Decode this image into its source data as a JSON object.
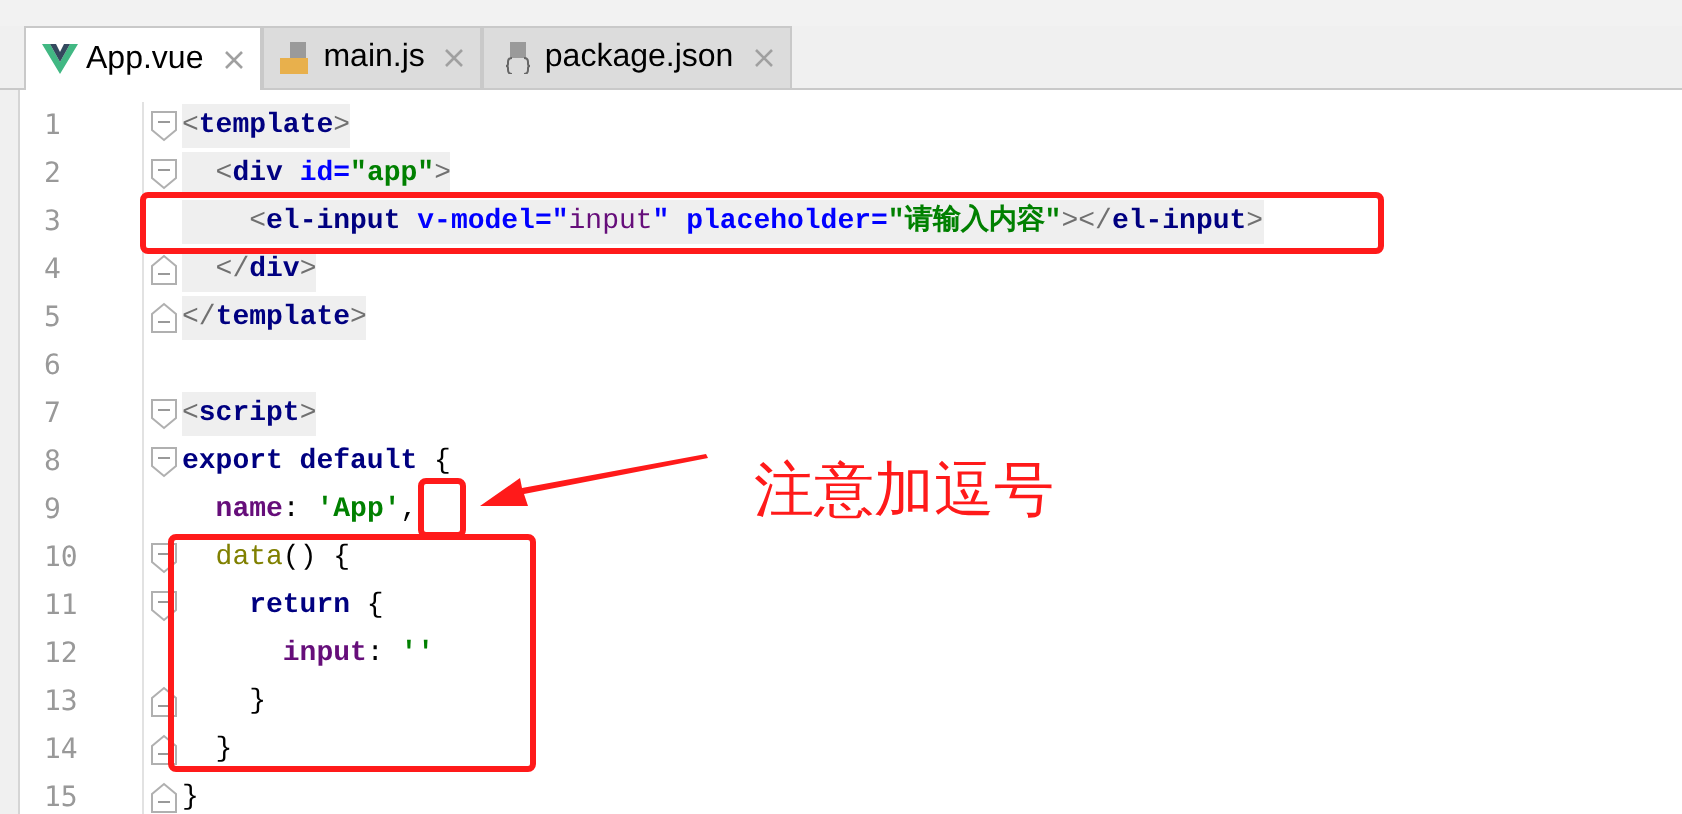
{
  "tabs": [
    {
      "label": "App.vue",
      "kind": "vue",
      "selected": true
    },
    {
      "label": "main.js",
      "kind": "js",
      "selected": false
    },
    {
      "label": "package.json",
      "kind": "json",
      "selected": false
    }
  ],
  "lines": [
    {
      "number": "1",
      "kind": "fold-start",
      "highlighted": true,
      "tokens": [
        {
          "kind": "bracket",
          "text": "<"
        },
        {
          "kind": "tag",
          "text": "template"
        },
        {
          "kind": "bracket",
          "text": ">"
        }
      ]
    },
    {
      "number": "2",
      "kind": "fold-start",
      "highlighted": true,
      "tokens": [
        {
          "kind": "bracket",
          "text": "  <"
        },
        {
          "kind": "tag",
          "text": "div "
        },
        {
          "kind": "attr",
          "text": "id="
        },
        {
          "kind": "string",
          "text": "\"app\""
        },
        {
          "kind": "bracket",
          "text": ">"
        }
      ]
    },
    {
      "number": "3",
      "kind": "plain",
      "highlighted": true,
      "tokens": [
        {
          "kind": "bracket",
          "text": "    <"
        },
        {
          "kind": "tag",
          "text": "el-input "
        },
        {
          "kind": "attr",
          "text": "v-model="
        },
        {
          "kind": "attr",
          "text": "\""
        },
        {
          "kind": "binding",
          "text": "input"
        },
        {
          "kind": "attr",
          "text": "\" placeholder="
        },
        {
          "kind": "string",
          "text": "\"请输入内容\""
        },
        {
          "kind": "bracket",
          "text": "></"
        },
        {
          "kind": "tag",
          "text": "el-input"
        },
        {
          "kind": "bracket",
          "text": ">"
        }
      ]
    },
    {
      "number": "4",
      "kind": "fold-end",
      "highlighted": true,
      "tokens": [
        {
          "kind": "bracket",
          "text": "  </"
        },
        {
          "kind": "tag",
          "text": "div"
        },
        {
          "kind": "bracket",
          "text": ">"
        }
      ]
    },
    {
      "number": "5",
      "kind": "fold-end",
      "highlighted": true,
      "tokens": [
        {
          "kind": "bracket",
          "text": "</"
        },
        {
          "kind": "tag",
          "text": "template"
        },
        {
          "kind": "bracket",
          "text": ">"
        }
      ]
    },
    {
      "number": "6",
      "kind": "plain"
    },
    {
      "number": "7",
      "kind": "fold-start",
      "highlighted": true,
      "tokens": [
        {
          "kind": "bracket",
          "text": "<"
        },
        {
          "kind": "tag",
          "text": "script"
        },
        {
          "kind": "bracket",
          "text": ">"
        }
      ]
    },
    {
      "number": "8",
      "kind": "fold-start",
      "highlighted": false,
      "tokens": [
        {
          "kind": "keyword",
          "text": "export default "
        },
        {
          "kind": "plain",
          "text": "{"
        }
      ]
    },
    {
      "number": "9",
      "kind": "plain",
      "highlighted": false,
      "tokens": [
        {
          "kind": "property",
          "text": "  name"
        },
        {
          "kind": "plain",
          "text": ": "
        },
        {
          "kind": "string",
          "text": "'App'"
        },
        {
          "kind": "plain",
          "text": ","
        }
      ]
    },
    {
      "number": "10",
      "kind": "fold-start",
      "highlighted": false,
      "tokens": [
        {
          "kind": "function",
          "text": "  data"
        },
        {
          "kind": "plain",
          "text": "() {"
        }
      ]
    },
    {
      "number": "11",
      "kind": "fold-start",
      "highlighted": false,
      "tokens": [
        {
          "kind": "keyword",
          "text": "    return "
        },
        {
          "kind": "plain",
          "text": "{"
        }
      ]
    },
    {
      "number": "12",
      "kind": "plain",
      "highlighted": false,
      "tokens": [
        {
          "kind": "property",
          "text": "      input"
        },
        {
          "kind": "plain",
          "text": ": "
        },
        {
          "kind": "string",
          "text": "''"
        }
      ]
    },
    {
      "number": "13",
      "kind": "fold-end",
      "highlighted": false,
      "tokens": [
        {
          "kind": "plain",
          "text": "    }"
        }
      ]
    },
    {
      "number": "14",
      "kind": "fold-end",
      "highlighted": false,
      "tokens": [
        {
          "kind": "plain",
          "text": "  }"
        }
      ]
    },
    {
      "number": "15",
      "kind": "fold-end",
      "highlighted": false,
      "tokens": [
        {
          "kind": "plain",
          "text": "}"
        }
      ]
    }
  ],
  "annotation": {
    "text": "注意加逗号"
  }
}
